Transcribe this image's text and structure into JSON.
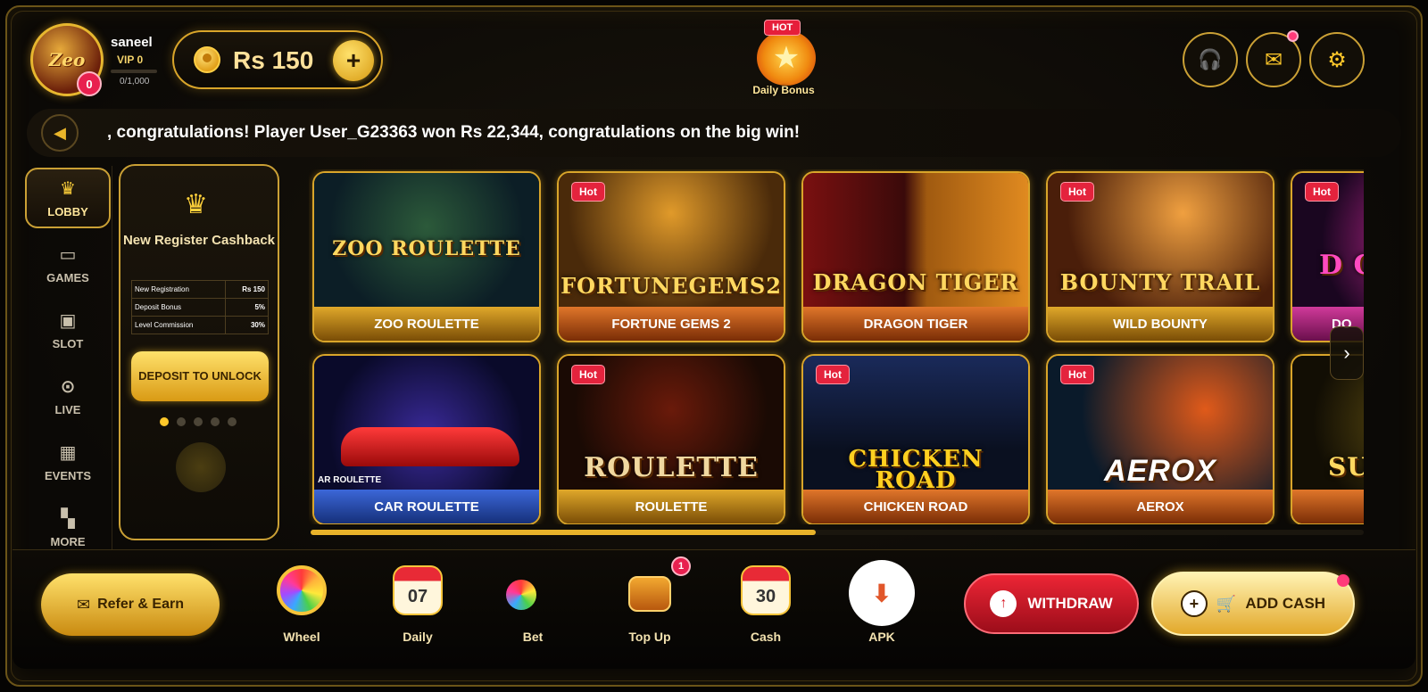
{
  "user": {
    "name": "saneel",
    "vip": "VIP 0",
    "vip_progress": "0/1,000",
    "badge_count": "0",
    "avatar_logo": "Zeo"
  },
  "balance": {
    "amount": "Rs 150",
    "add_label": "+"
  },
  "daily_bonus": {
    "tag": "HOT",
    "label": "Daily Bonus"
  },
  "header_buttons": [
    {
      "name": "headset-icon",
      "glyph": "☊"
    },
    {
      "name": "mail-icon",
      "glyph": "✉"
    },
    {
      "name": "settings-icon",
      "glyph": "⚙"
    }
  ],
  "marquee": {
    "text": ", congratulations! Player User_G23363 won Rs 22,344, congratulations on the big win!"
  },
  "sidebar": {
    "items": [
      {
        "label": "LOBBY",
        "icon": "crown-icon",
        "glyph": "♛",
        "active": true
      },
      {
        "label": "GAMES",
        "icon": "gamepad-icon",
        "glyph": "▭",
        "active": false
      },
      {
        "label": "SLOT",
        "icon": "slot-icon",
        "glyph": "▣",
        "active": false
      },
      {
        "label": "LIVE",
        "icon": "play-icon",
        "glyph": "▶",
        "active": false
      },
      {
        "label": "EVENTS",
        "icon": "calendar-icon",
        "glyph": "▦",
        "active": false
      },
      {
        "label": "MORE",
        "icon": "grid-icon",
        "glyph": "▦",
        "active": false
      }
    ]
  },
  "promo": {
    "title": "New Register Cashback",
    "rows": [
      {
        "k": "New Registration",
        "v": "Rs 150"
      },
      {
        "k": "Deposit Bonus",
        "v": "5%"
      },
      {
        "k": "Level Commission",
        "v": "30%"
      }
    ],
    "button": "DEPOSIT TO UNLOCK"
  },
  "games": [
    {
      "name": "ZOO ROULETTE",
      "art_title": "ZOO ROULETTE",
      "hot": false
    },
    {
      "name": "FORTUNE GEMS 2",
      "art_title": "FORTUNEGEMS2",
      "hot": true
    },
    {
      "name": "DRAGON TIGER",
      "art_title": "DRAGON TIGER",
      "hot": false
    },
    {
      "name": "WILD BOUNTY",
      "art_title": "BOUNTY TRAIL",
      "hot": true
    },
    {
      "name": "DO",
      "art_title": "D C",
      "hot": true
    },
    {
      "name": "CAR ROULETTE",
      "art_title": "",
      "art_caption": "AR ROULETTE",
      "hot": false
    },
    {
      "name": "ROULETTE",
      "art_title": "ROULETTE",
      "hot": true
    },
    {
      "name": "CHICKEN ROAD",
      "art_title": "CHICKEN ROAD",
      "hot": true
    },
    {
      "name": "AEROX",
      "art_title": "AEROX",
      "hot": true
    },
    {
      "name": "",
      "art_title": "SU",
      "hot": false
    }
  ],
  "hot_label": "Hot",
  "bottom": {
    "refer": "Refer & Earn",
    "nav": [
      {
        "label": "Wheel",
        "icon": "wheel-icon",
        "value": ""
      },
      {
        "label": "Daily",
        "icon": "calendar-icon",
        "value": "07"
      },
      {
        "label": "Bet",
        "icon": "bet-icon",
        "value": ""
      },
      {
        "label": "Top Up",
        "icon": "treasure-chest-icon",
        "value": "",
        "badge": "1"
      },
      {
        "label": "Cash",
        "icon": "calendar-icon",
        "value": "30"
      },
      {
        "label": "APK",
        "icon": "download-icon",
        "value": ""
      }
    ],
    "withdraw": "WITHDRAW",
    "add_cash": "ADD CASH"
  }
}
